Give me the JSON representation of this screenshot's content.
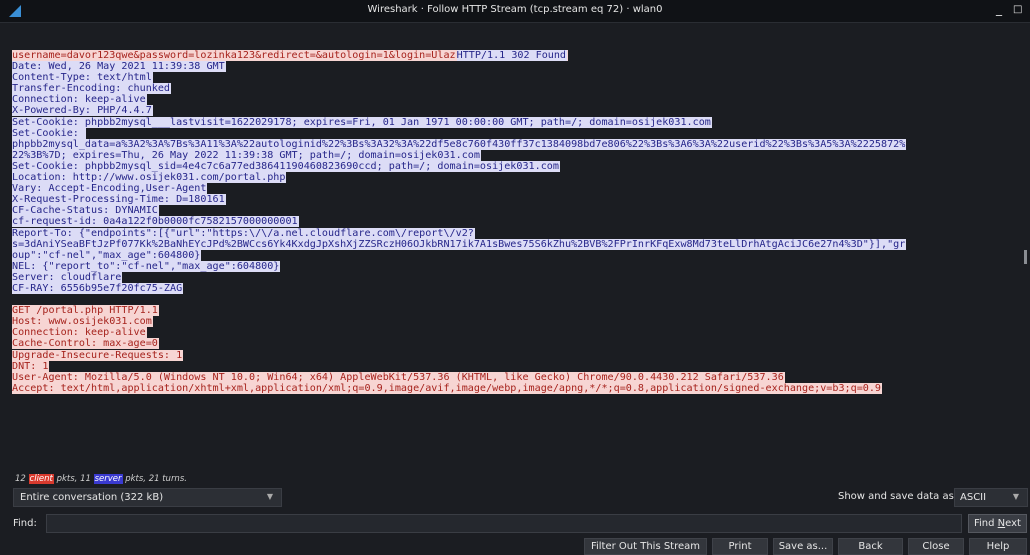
{
  "window": {
    "title": "Wireshark · Follow HTTP Stream (tcp.stream eq 72) · wlan0",
    "minimize": "_",
    "maximize": "□"
  },
  "stream": {
    "blocks": [
      {
        "type": "c",
        "lines": [
          "username=davor123qwe&password=lozinka123&redirect=&autologin=1&login=Ulaz"
        ],
        "tail": "HTTP/1.1 302 Found"
      },
      {
        "type": "s",
        "lines": [
          "Date: Wed, 26 May 2021 11:39:38 GMT",
          "Content-Type: text/html",
          "Transfer-Encoding: chunked",
          "Connection: keep-alive",
          "X-Powered-By: PHP/4.4.7",
          "Set-Cookie: phpbb2mysql___lastvisit=1622029178; expires=Fri, 01 Jan 1971 00:00:00 GMT; path=/; domain=osijek031.com",
          "Set-Cookie: ",
          "phpbb2mysql_data=a%3A2%3A%7Bs%3A11%3A%22autologinid%22%3Bs%3A32%3A%22df5e8c760f430ff37c1384098bd7e806%22%3Bs%3A6%3A%22userid%22%3Bs%3A5%3A%2225872%",
          "22%3B%7D; expires=Thu, 26 May 2022 11:39:38 GMT; path=/; domain=osijek031.com",
          "Set-Cookie: phpbb2mysql_sid=4e4c7c6a77ed38641190460823690ccd; path=/; domain=osijek031.com",
          "Location: http://www.osijek031.com/portal.php",
          "Vary: Accept-Encoding,User-Agent",
          "X-Request-Processing-Time: D=180161",
          "CF-Cache-Status: DYNAMIC",
          "cf-request-id: 0a4a122f0b0000fc7582157000000001",
          "Report-To: {\"endpoints\":[{\"url\":\"https:\\/\\/a.nel.cloudflare.com\\/report\\/v2?",
          "s=3dAniYSeaBFtJzPf077Kk%2BaNhEYcJPd%2BWCcs6Yk4KxdgJpXshXjZZSRczH06OJkbRN17ik7A1sBwes75S6kZhu%2BVB%2FPrInrKFqExw8Md73teLlDrhAtgAciJC6e27n4%3D\"}],\"gr",
          "oup\":\"cf-nel\",\"max_age\":604800}",
          "NEL: {\"report_to\":\"cf-nel\",\"max_age\":604800}",
          "Server: cloudflare",
          "CF-RAY: 6556b95e7f20fc75-ZAG"
        ]
      },
      {
        "type": "blank"
      },
      {
        "type": "c",
        "lines": [
          "GET /portal.php HTTP/1.1",
          "Host: www.osijek031.com",
          "Connection: keep-alive",
          "Cache-Control: max-age=0",
          "Upgrade-Insecure-Requests: 1",
          "DNT: 1",
          "User-Agent: Mozilla/5.0 (Windows NT 10.0; Win64; x64) AppleWebKit/537.36 (KHTML, like Gecko) Chrome/90.0.4430.212 Safari/537.36",
          "Accept: text/html,application/xhtml+xml,application/xml;q=0.9,image/avif,image/webp,image/apng,*/*;q=0.8,application/signed-exchange;v=b3;q=0.9"
        ]
      }
    ]
  },
  "stats": {
    "client_count": "12",
    "client_label": "client",
    "pkts_text_1": " pkts, 11 ",
    "server_label": "server",
    "pkts_text_2": " pkts, 21 turns."
  },
  "controls": {
    "conversation": "Entire conversation (322 kB)",
    "show_label": "Show and save data as",
    "format": "ASCII",
    "find_label": "Find:",
    "find_value": "",
    "find_next_pre": "Find ",
    "find_next_u": "N",
    "find_next_post": "ext"
  },
  "buttons": {
    "filter_out": "Filter Out This Stream",
    "print": "Print",
    "save_as": "Save as...",
    "back": "Back",
    "close": "Close",
    "help": "Help"
  },
  "colors": {
    "client_bg": "#f7d5d3",
    "client_fg": "#a6231d",
    "server_bg": "#dcdcf6",
    "server_fg": "#26268a",
    "accent": "#3a8fd6"
  }
}
